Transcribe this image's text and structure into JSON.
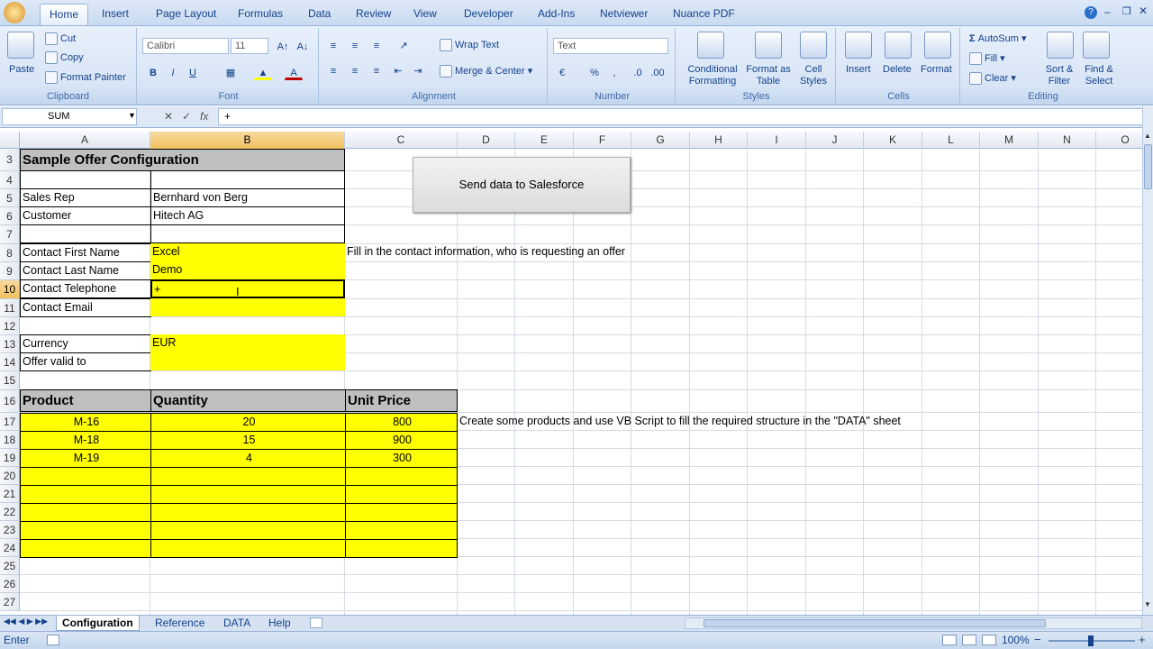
{
  "ribbon": {
    "tabs": [
      "Home",
      "Insert",
      "Page Layout",
      "Formulas",
      "Data",
      "Review",
      "View",
      "Developer",
      "Add-Ins",
      "Netviewer",
      "Nuance PDF"
    ],
    "clipboard": {
      "paste": "Paste",
      "cut": "Cut",
      "copy": "Copy",
      "format_painter": "Format Painter",
      "label": "Clipboard"
    },
    "font": {
      "name": "Calibri",
      "size": "11",
      "label": "Font",
      "bold": "B",
      "italic": "I",
      "underline": "U"
    },
    "alignment": {
      "wrap": "Wrap Text",
      "merge": "Merge & Center",
      "label": "Alignment"
    },
    "number": {
      "format": "Text",
      "label": "Number",
      "percent": "%",
      "comma": ","
    },
    "styles": {
      "conditional": "Conditional Formatting",
      "format_table": "Format as Table",
      "cell_styles": "Cell Styles",
      "label": "Styles"
    },
    "cells": {
      "insert": "Insert",
      "delete": "Delete",
      "format": "Format",
      "label": "Cells"
    },
    "editing": {
      "autosum": "AutoSum",
      "fill": "Fill",
      "clear": "Clear",
      "sort": "Sort & Filter",
      "find": "Find & Select",
      "label": "Editing"
    }
  },
  "formula_bar": {
    "name_box": "SUM",
    "fx": "fx",
    "value": "+"
  },
  "columns": [
    "A",
    "B",
    "C",
    "D",
    "E",
    "F",
    "G",
    "H",
    "I",
    "J",
    "K",
    "L",
    "M",
    "N",
    "O"
  ],
  "rows": [
    "3",
    "4",
    "5",
    "6",
    "7",
    "8",
    "9",
    "10",
    "11",
    "12",
    "13",
    "14",
    "15",
    "16",
    "17",
    "18",
    "19",
    "20",
    "21",
    "22",
    "23",
    "24",
    "25",
    "26",
    "27"
  ],
  "sheet": {
    "title": "Sample Offer Configuration",
    "sales_rep_label": "Sales Rep",
    "sales_rep": "Bernhard von Berg",
    "customer_label": "Customer",
    "customer": "Hitech AG",
    "first_name_label": "Contact First Name",
    "first_name": "Excel",
    "last_name_label": "Contact Last Name",
    "last_name": "Demo",
    "telephone_label": "Contact Telephone",
    "telephone": "+",
    "email_label": "Contact Email",
    "currency_label": "Currency",
    "currency": "EUR",
    "valid_label": "Offer valid to",
    "contact_note": "Fill in the contact information, who is requesting an offer",
    "products_note": "Create some products and use VB Script to fill the required structure in the \"DATA\" sheet",
    "table_headers": {
      "product": "Product",
      "quantity": "Quantity",
      "unit_price": "Unit Price"
    },
    "products": [
      {
        "product": "M-16",
        "quantity": "20",
        "unit_price": "800"
      },
      {
        "product": "M-18",
        "quantity": "15",
        "unit_price": "900"
      },
      {
        "product": "M-19",
        "quantity": "4",
        "unit_price": "300"
      }
    ],
    "button": "Send data to Salesforce"
  },
  "sheet_tabs": [
    "Configuration",
    "Reference",
    "DATA",
    "Help"
  ],
  "status": {
    "mode": "Enter",
    "zoom": "100%"
  }
}
